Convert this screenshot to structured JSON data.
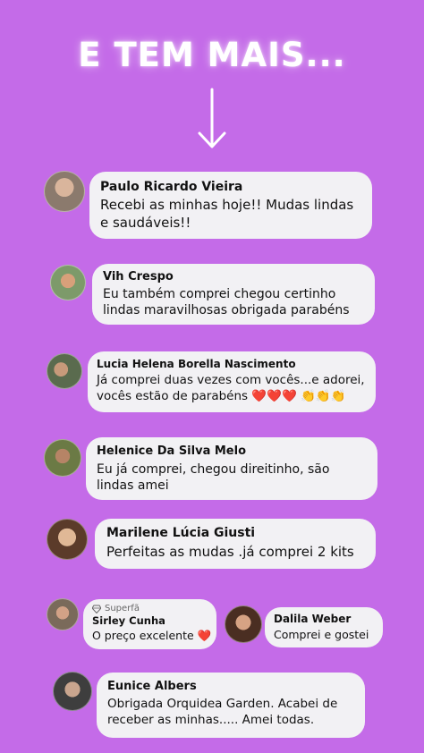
{
  "header": {
    "title": "E TEM MAIS..."
  },
  "comments": [
    {
      "name": "Paulo Ricardo Vieira",
      "text": "Recebi as minhas hoje!! Mudas lindas e saudáveis!!"
    },
    {
      "name": "Vih Crespo",
      "text": "Eu também comprei chegou certinho lindas maravilhosas obrigada parabéns"
    },
    {
      "name": "Lucia Helena Borella Nascimento",
      "text": "Já comprei duas vezes com vocês...e adorei, vocês estão de parabéns ❤️❤️❤️ 👏👏👏"
    },
    {
      "name": "Helenice Da Silva Melo",
      "text": "Eu já comprei, chegou direitinho, são lindas amei"
    },
    {
      "name": "Marilene Lúcia Giusti",
      "text": "Perfeitas as mudas .já comprei 2 kits"
    },
    {
      "badge": "Superfã",
      "name": "Sirley Cunha",
      "text": "O preço excelente ❤️"
    },
    {
      "name": "Dalila Weber",
      "text": "Comprei e gostei"
    },
    {
      "name": "Eunice Albers",
      "text": "Obrigada Orquidea  Garden. Acabei de receber as minhas..... Amei todas."
    }
  ],
  "colors": {
    "background": "#c46be8",
    "bubble": "#f2f1f4",
    "title": "#ffffff"
  },
  "icons": {
    "arrow": "arrow-down-icon",
    "badge": "diamond-icon"
  }
}
